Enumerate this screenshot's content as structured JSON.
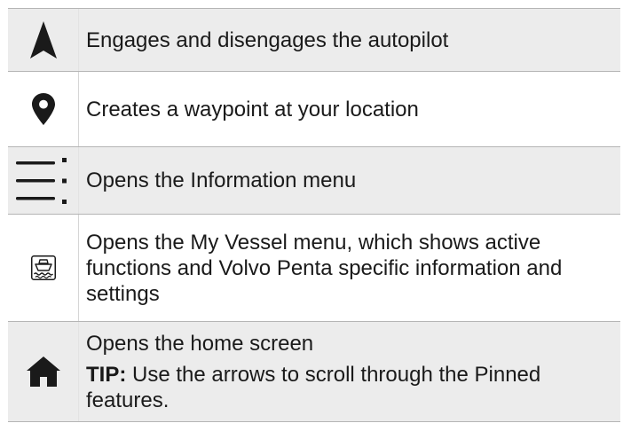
{
  "rows": [
    {
      "icon": "navigation-arrow-icon",
      "description": "Engages and disengages the autopilot"
    },
    {
      "icon": "map-pin-icon",
      "description": "Creates a waypoint at your location"
    },
    {
      "icon": "information-menu-icon",
      "description": "Opens the Information menu"
    },
    {
      "icon": "my-vessel-icon",
      "description": "Opens the My Vessel menu, which shows active functions and Volvo Penta specific information and settings"
    },
    {
      "icon": "home-icon",
      "description": "Opens the home screen",
      "tip_label": "TIP:",
      "tip_text": " Use the arrows to scroll through the Pinned features."
    }
  ],
  "colors": {
    "shaded_row": "#ececec",
    "plain_row": "#ffffff",
    "border": "#b5b5b5",
    "icon": "#1a1a1a"
  }
}
